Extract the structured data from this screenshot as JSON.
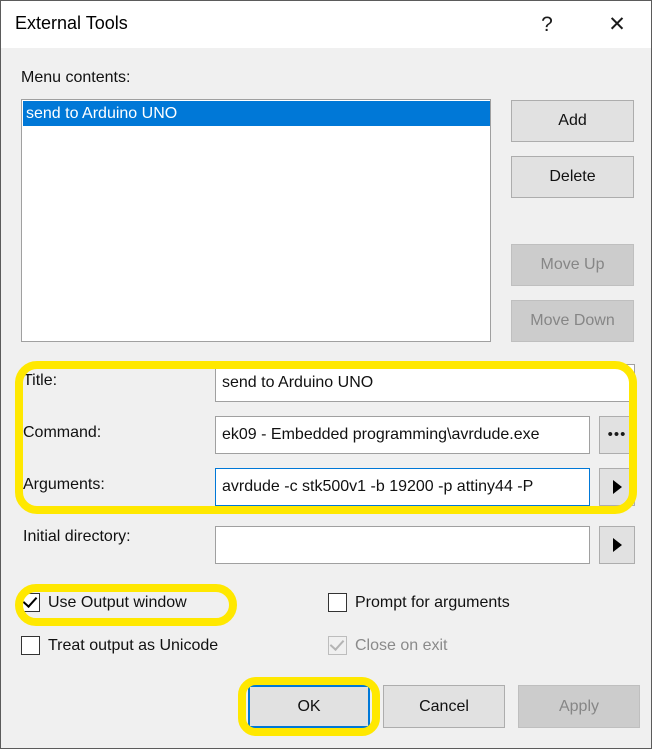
{
  "window": {
    "title": "External Tools",
    "help_icon": "question-mark-icon",
    "close_icon": "close-x-icon",
    "help_glyph": "?",
    "close_glyph": "✕"
  },
  "menu_contents": {
    "label": "Menu contents:",
    "items": [
      {
        "text": "send to Arduino UNO",
        "selected": true
      }
    ],
    "selection_color": "#0078d7"
  },
  "side_buttons": [
    {
      "label": "Add",
      "enabled": true
    },
    {
      "label": "Delete",
      "enabled": true
    },
    {
      "label": "Move Up",
      "enabled": false
    },
    {
      "label": "Move Down",
      "enabled": false
    }
  ],
  "fields": {
    "title": {
      "label": "Title:",
      "value": "send to Arduino UNO",
      "placeholder": "",
      "focused": false
    },
    "command": {
      "label": "Command:",
      "value": "ek09 - Embedded programming\\avrdude.exe",
      "placeholder": "",
      "focused": false,
      "browse_label": "•••",
      "browse_icon": "ellipsis-icon"
    },
    "arguments": {
      "label": "Arguments:",
      "value": "avrdude  -c stk500v1 -b 19200 -p attiny44 -P",
      "placeholder": "",
      "focused": true,
      "menu_icon": "triangle-right-icon"
    },
    "initial_directory": {
      "label": "Initial directory:",
      "value": "",
      "placeholder": "",
      "focused": false,
      "menu_icon": "triangle-right-icon"
    }
  },
  "checkboxes": {
    "use_output_window": {
      "label": "Use Output window",
      "checked": true,
      "enabled": true
    },
    "prompt_for_arguments": {
      "label": "Prompt for arguments",
      "checked": false,
      "enabled": true
    },
    "treat_output_as_unicode": {
      "label": "Treat output as Unicode",
      "checked": false,
      "enabled": true
    },
    "close_on_exit": {
      "label": "Close on exit",
      "checked": true,
      "enabled": false
    }
  },
  "dialog_buttons": {
    "ok": {
      "label": "OK",
      "enabled": true,
      "default": true
    },
    "cancel": {
      "label": "Cancel",
      "enabled": true
    },
    "apply": {
      "label": "Apply",
      "enabled": false
    }
  },
  "annotations": {
    "highlight_color": "#ffe800",
    "shapes": [
      {
        "name": "fields-group",
        "kind": "rounded-rect"
      },
      {
        "name": "use-output-window",
        "kind": "ellipse"
      },
      {
        "name": "ok-button",
        "kind": "rounded-rect"
      }
    ]
  }
}
